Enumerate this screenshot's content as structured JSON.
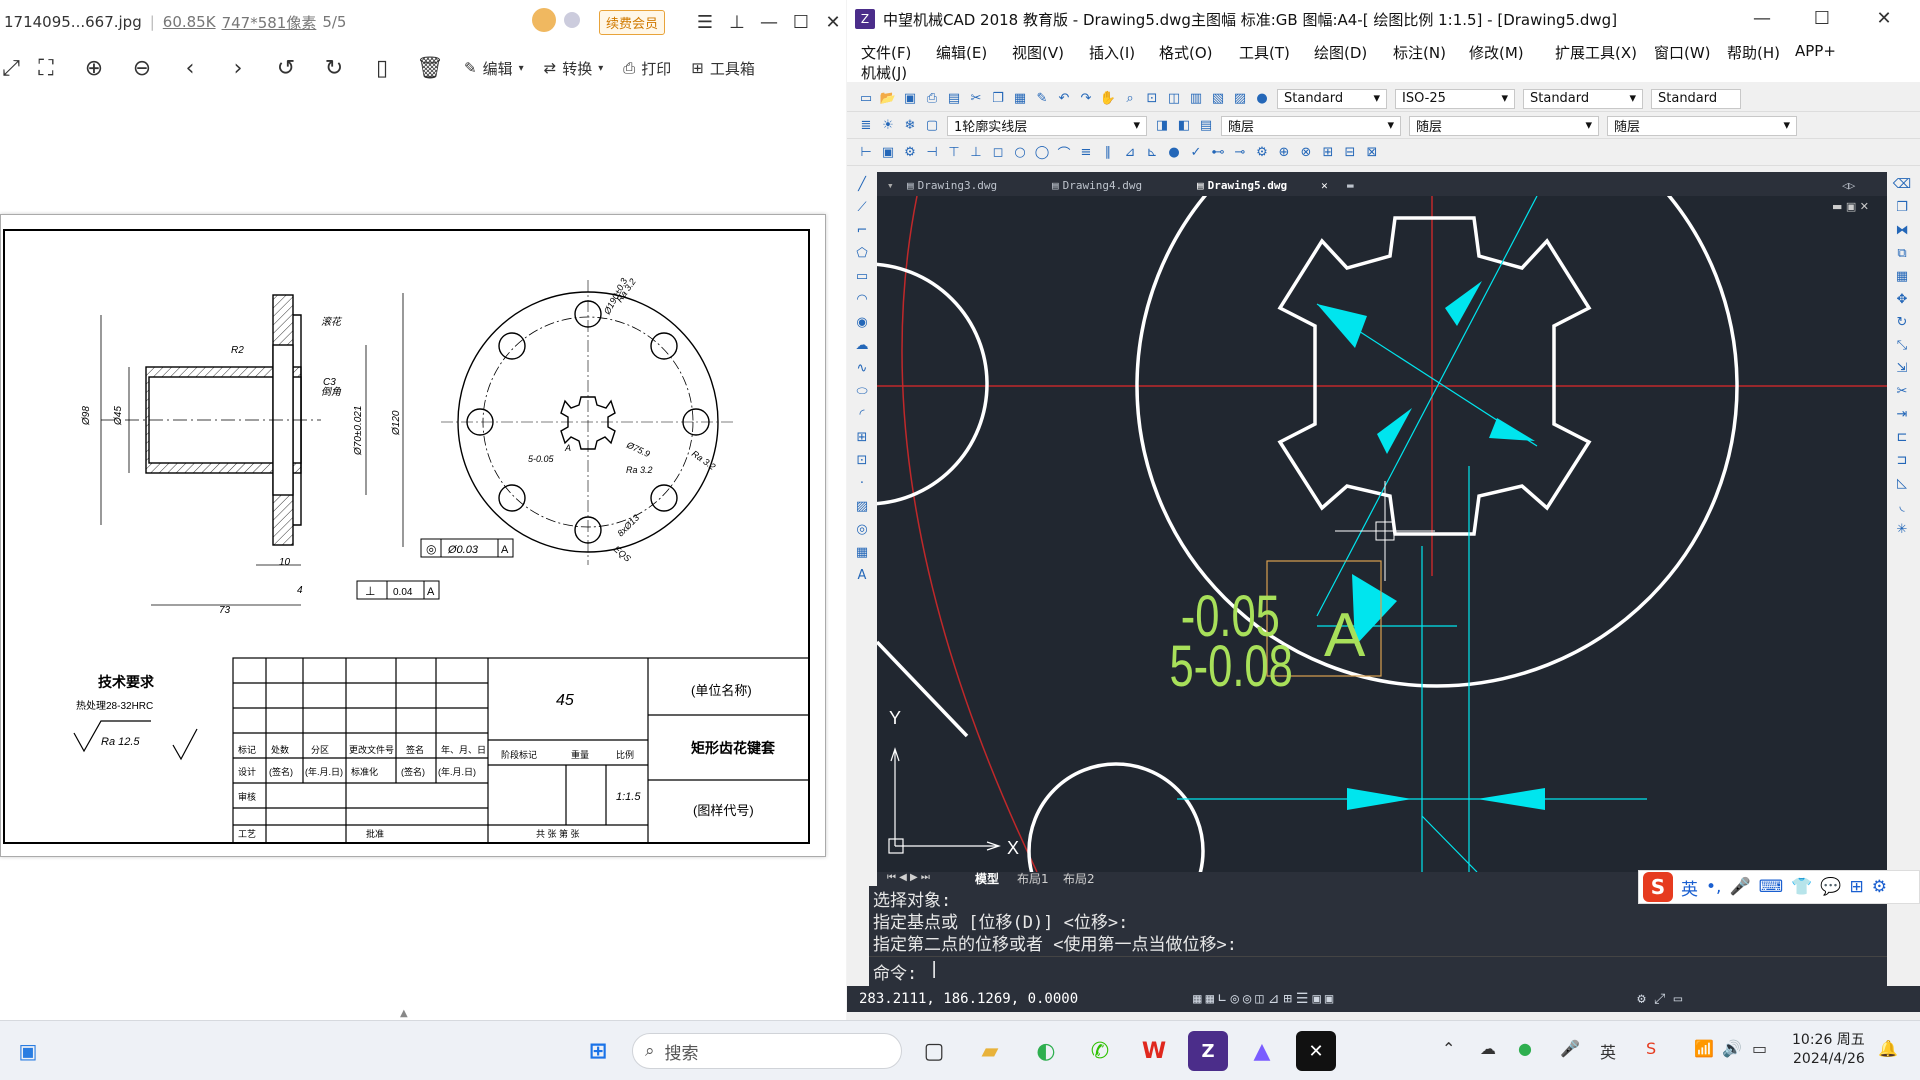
{
  "viewer": {
    "filename": "1714095...667.jpg",
    "filesize": "60.85K",
    "dimensions": "747*581像素",
    "page_index": "5/5",
    "vip_label": "续费会员",
    "toolbar": {
      "edit_label": "编辑",
      "convert_label": "转换",
      "print_label": "打印",
      "toolbox_label": "工具箱"
    }
  },
  "drawing": {
    "dims_left": [
      "Ø98",
      "Ø45",
      "Ø70±0.021",
      "Ø120",
      "R2",
      "C3",
      "10",
      "4",
      "73"
    ],
    "labels": [
      "滚花",
      "倒角"
    ],
    "circle_labels": [
      "Ø190±0.3",
      "Ra 3.2",
      "Ø75.9",
      "5-0.05",
      "Ra 3.2",
      "Ra 3.2",
      "8xØ13",
      "EQS",
      "A"
    ],
    "tolerance_1": {
      "symbol": "◎",
      "value": "Ø0.03",
      "datum": "A"
    },
    "tolerance_2": {
      "symbol": "⊥",
      "value": "0.04",
      "datum": "A"
    },
    "tech_title": "技术要求",
    "tech_note": "热处理28-32HRC",
    "roughness": "Ra 12.5",
    "material": "45",
    "unit_name": "(单位名称)",
    "part_name": "矩形齿花键套",
    "drawing_code": "(图样代号)",
    "scale": "1:1.5",
    "title_rows": {
      "r1": [
        "标记",
        "处数",
        "分区",
        "更改文件号",
        "签名",
        "年、月、日"
      ],
      "r2": [
        "设计",
        "(签名)",
        "(年.月.日)",
        "标准化",
        "(签名)",
        "(年.月.日)"
      ],
      "r3": [
        "审核"
      ],
      "r4": [
        "工艺",
        "批准"
      ],
      "stage": "阶段标记",
      "weight": "重量",
      "ratio": "比例",
      "sheets": "共 张 第 张"
    }
  },
  "cad": {
    "title": "中望机械CAD 2018 教育版 - Drawing5.dwg主图幅  标准:GB 图幅:A4-[ 绘图比例 1:1.5] - [Drawing5.dwg]",
    "menus": [
      "文件(F)",
      "编辑(E)",
      "视图(V)",
      "插入(I)",
      "格式(O)",
      "工具(T)",
      "绘图(D)",
      "标注(N)",
      "修改(M)",
      "扩展工具(X)",
      "窗口(W)",
      "帮助(H)",
      "APP+"
    ],
    "menu_row2": "机械(J)",
    "style_dropdowns": [
      "Standard",
      "ISO-25",
      "Standard",
      "Standard"
    ],
    "layer_dropdown": "1轮廓实线层",
    "color_dropdown": "随层",
    "linetype_dropdown": "随层",
    "lineweight_dropdown": "随层",
    "doc_tabs": [
      "Drawing3.dwg",
      "Drawing4.dwg",
      "Drawing5.dwg"
    ],
    "layout_tabs": [
      "模型",
      "布局1",
      "布局2"
    ],
    "dim_text_1": "-0.05",
    "dim_text_2": "5-0.08",
    "datum_letter": "A",
    "ucs_x": "X",
    "ucs_y": "Y",
    "cmd_lines": [
      "选择对象:",
      "指定基点或 [位移(D)] <位移>:",
      "指定第二点的位移或者 <使用第一点当做位移>:"
    ],
    "cmd_prompt": "命令:",
    "coords": "283.2111, 186.1269, 0.0000",
    "ime_lang": "英"
  },
  "taskbar": {
    "search_placeholder": "搜索",
    "time": "10:26 周五",
    "date": "2024/4/26"
  },
  "colors": {
    "cad_bg": "#212730",
    "cyan": "#00e5ee",
    "red_line": "#c0282a",
    "green_text": "#a8e05a",
    "orange_box": "#d9a050"
  }
}
